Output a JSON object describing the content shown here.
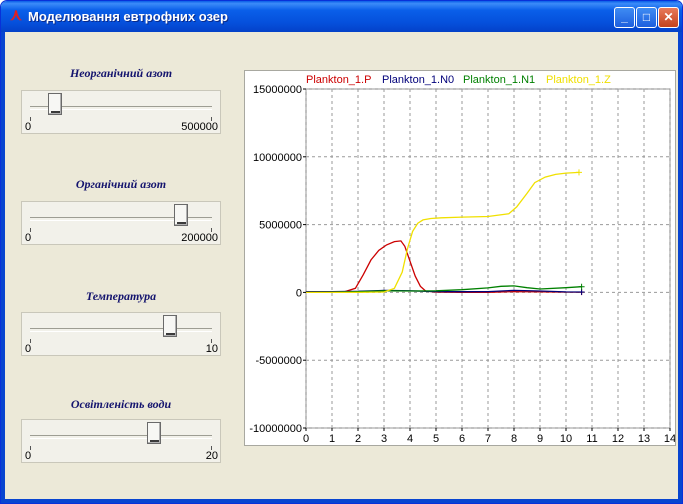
{
  "window": {
    "title": "Моделювання евтрофних озер",
    "buttons": {
      "minimize": "_",
      "maximize": "□",
      "close": "✕"
    }
  },
  "controls": [
    {
      "label": "Неорганічний азот",
      "min": "0",
      "max": "500000",
      "position_fraction": 0.14
    },
    {
      "label": "Органічний азот",
      "min": "0",
      "max": "200000",
      "position_fraction": 0.83
    },
    {
      "label": "Температура",
      "min": "0",
      "max": "10",
      "position_fraction": 0.77
    },
    {
      "label": "Освітленість води",
      "min": "0",
      "max": "20",
      "position_fraction": 0.68
    }
  ],
  "chart_data": {
    "type": "line",
    "legend_position": "top",
    "grid": true,
    "xlim": [
      0,
      14
    ],
    "ylim": [
      -10000000,
      15000000
    ],
    "x_ticks": [
      0,
      1,
      2,
      3,
      4,
      5,
      6,
      7,
      8,
      9,
      10,
      11,
      12,
      13,
      14
    ],
    "y_ticks": [
      {
        "value": 15000000,
        "label": "15000000"
      },
      {
        "value": 10000000,
        "label": "10000000"
      },
      {
        "value": 5000000,
        "label": "5000000"
      },
      {
        "value": 0,
        "label": "0"
      },
      {
        "value": -5000000,
        "label": "-5000000"
      },
      {
        "value": -10000000,
        "label": "-10000000"
      }
    ],
    "series": [
      {
        "name": "Plankton_1.P",
        "color": "#cc0000",
        "x": [
          0,
          0.5,
          1,
          1.5,
          1.9,
          2.2,
          2.5,
          2.8,
          3.1,
          3.4,
          3.65,
          3.8,
          4.0,
          4.2,
          4.4,
          4.6,
          5,
          6,
          7,
          8,
          9,
          10,
          10.6
        ],
        "y": [
          0,
          0,
          20000,
          60000,
          300000,
          1300000,
          2400000,
          3100000,
          3500000,
          3750000,
          3800000,
          3400000,
          2300000,
          1200000,
          450000,
          100000,
          20000,
          10000,
          10000,
          60000,
          40000,
          20000,
          20000
        ]
      },
      {
        "name": "Plankton_1.N0",
        "color": "#00007a",
        "x": [
          0,
          1,
          2,
          3,
          4,
          5,
          6,
          7,
          8,
          9,
          10,
          10.6
        ],
        "y": [
          50000,
          60000,
          80000,
          150000,
          120000,
          60000,
          50000,
          60000,
          150000,
          100000,
          40000,
          30000
        ]
      },
      {
        "name": "Plankton_1.N1",
        "color": "#008000",
        "x": [
          0,
          1,
          2,
          3,
          4,
          5,
          6,
          7,
          7.5,
          8,
          8.5,
          9,
          10,
          10.6
        ],
        "y": [
          0,
          20000,
          60000,
          120000,
          100000,
          120000,
          200000,
          330000,
          450000,
          480000,
          350000,
          250000,
          350000,
          420000
        ]
      },
      {
        "name": "Plankton_1.Z",
        "color": "#f0e000",
        "x": [
          0,
          1,
          2,
          3,
          3.4,
          3.7,
          3.9,
          4.1,
          4.3,
          4.5,
          4.8,
          5.2,
          6,
          7,
          7.8,
          8.1,
          8.5,
          8.8,
          9.2,
          9.6,
          10,
          10.5
        ],
        "y": [
          0,
          0,
          0,
          30000,
          300000,
          1500000,
          3200000,
          4500000,
          5100000,
          5350000,
          5450000,
          5500000,
          5550000,
          5600000,
          5800000,
          6300000,
          7300000,
          8100000,
          8500000,
          8700000,
          8800000,
          8850000
        ]
      }
    ]
  }
}
